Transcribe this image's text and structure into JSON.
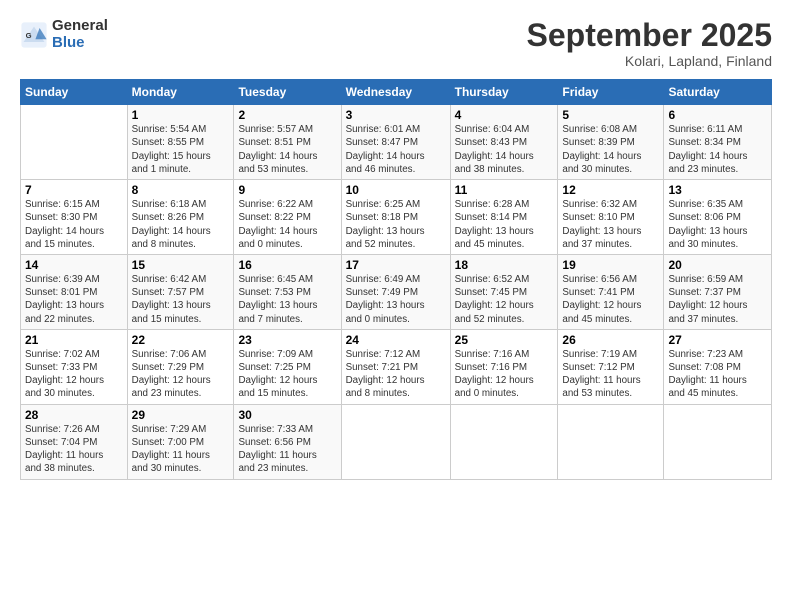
{
  "logo": {
    "general": "General",
    "blue": "Blue"
  },
  "title": "September 2025",
  "location": "Kolari, Lapland, Finland",
  "days_of_week": [
    "Sunday",
    "Monday",
    "Tuesday",
    "Wednesday",
    "Thursday",
    "Friday",
    "Saturday"
  ],
  "weeks": [
    [
      {
        "day": "",
        "info": ""
      },
      {
        "day": "1",
        "info": "Sunrise: 5:54 AM\nSunset: 8:55 PM\nDaylight: 15 hours\nand 1 minute."
      },
      {
        "day": "2",
        "info": "Sunrise: 5:57 AM\nSunset: 8:51 PM\nDaylight: 14 hours\nand 53 minutes."
      },
      {
        "day": "3",
        "info": "Sunrise: 6:01 AM\nSunset: 8:47 PM\nDaylight: 14 hours\nand 46 minutes."
      },
      {
        "day": "4",
        "info": "Sunrise: 6:04 AM\nSunset: 8:43 PM\nDaylight: 14 hours\nand 38 minutes."
      },
      {
        "day": "5",
        "info": "Sunrise: 6:08 AM\nSunset: 8:39 PM\nDaylight: 14 hours\nand 30 minutes."
      },
      {
        "day": "6",
        "info": "Sunrise: 6:11 AM\nSunset: 8:34 PM\nDaylight: 14 hours\nand 23 minutes."
      }
    ],
    [
      {
        "day": "7",
        "info": "Sunrise: 6:15 AM\nSunset: 8:30 PM\nDaylight: 14 hours\nand 15 minutes."
      },
      {
        "day": "8",
        "info": "Sunrise: 6:18 AM\nSunset: 8:26 PM\nDaylight: 14 hours\nand 8 minutes."
      },
      {
        "day": "9",
        "info": "Sunrise: 6:22 AM\nSunset: 8:22 PM\nDaylight: 14 hours\nand 0 minutes."
      },
      {
        "day": "10",
        "info": "Sunrise: 6:25 AM\nSunset: 8:18 PM\nDaylight: 13 hours\nand 52 minutes."
      },
      {
        "day": "11",
        "info": "Sunrise: 6:28 AM\nSunset: 8:14 PM\nDaylight: 13 hours\nand 45 minutes."
      },
      {
        "day": "12",
        "info": "Sunrise: 6:32 AM\nSunset: 8:10 PM\nDaylight: 13 hours\nand 37 minutes."
      },
      {
        "day": "13",
        "info": "Sunrise: 6:35 AM\nSunset: 8:06 PM\nDaylight: 13 hours\nand 30 minutes."
      }
    ],
    [
      {
        "day": "14",
        "info": "Sunrise: 6:39 AM\nSunset: 8:01 PM\nDaylight: 13 hours\nand 22 minutes."
      },
      {
        "day": "15",
        "info": "Sunrise: 6:42 AM\nSunset: 7:57 PM\nDaylight: 13 hours\nand 15 minutes."
      },
      {
        "day": "16",
        "info": "Sunrise: 6:45 AM\nSunset: 7:53 PM\nDaylight: 13 hours\nand 7 minutes."
      },
      {
        "day": "17",
        "info": "Sunrise: 6:49 AM\nSunset: 7:49 PM\nDaylight: 13 hours\nand 0 minutes."
      },
      {
        "day": "18",
        "info": "Sunrise: 6:52 AM\nSunset: 7:45 PM\nDaylight: 12 hours\nand 52 minutes."
      },
      {
        "day": "19",
        "info": "Sunrise: 6:56 AM\nSunset: 7:41 PM\nDaylight: 12 hours\nand 45 minutes."
      },
      {
        "day": "20",
        "info": "Sunrise: 6:59 AM\nSunset: 7:37 PM\nDaylight: 12 hours\nand 37 minutes."
      }
    ],
    [
      {
        "day": "21",
        "info": "Sunrise: 7:02 AM\nSunset: 7:33 PM\nDaylight: 12 hours\nand 30 minutes."
      },
      {
        "day": "22",
        "info": "Sunrise: 7:06 AM\nSunset: 7:29 PM\nDaylight: 12 hours\nand 23 minutes."
      },
      {
        "day": "23",
        "info": "Sunrise: 7:09 AM\nSunset: 7:25 PM\nDaylight: 12 hours\nand 15 minutes."
      },
      {
        "day": "24",
        "info": "Sunrise: 7:12 AM\nSunset: 7:21 PM\nDaylight: 12 hours\nand 8 minutes."
      },
      {
        "day": "25",
        "info": "Sunrise: 7:16 AM\nSunset: 7:16 PM\nDaylight: 12 hours\nand 0 minutes."
      },
      {
        "day": "26",
        "info": "Sunrise: 7:19 AM\nSunset: 7:12 PM\nDaylight: 11 hours\nand 53 minutes."
      },
      {
        "day": "27",
        "info": "Sunrise: 7:23 AM\nSunset: 7:08 PM\nDaylight: 11 hours\nand 45 minutes."
      }
    ],
    [
      {
        "day": "28",
        "info": "Sunrise: 7:26 AM\nSunset: 7:04 PM\nDaylight: 11 hours\nand 38 minutes."
      },
      {
        "day": "29",
        "info": "Sunrise: 7:29 AM\nSunset: 7:00 PM\nDaylight: 11 hours\nand 30 minutes."
      },
      {
        "day": "30",
        "info": "Sunrise: 7:33 AM\nSunset: 6:56 PM\nDaylight: 11 hours\nand 23 minutes."
      },
      {
        "day": "",
        "info": ""
      },
      {
        "day": "",
        "info": ""
      },
      {
        "day": "",
        "info": ""
      },
      {
        "day": "",
        "info": ""
      }
    ]
  ]
}
